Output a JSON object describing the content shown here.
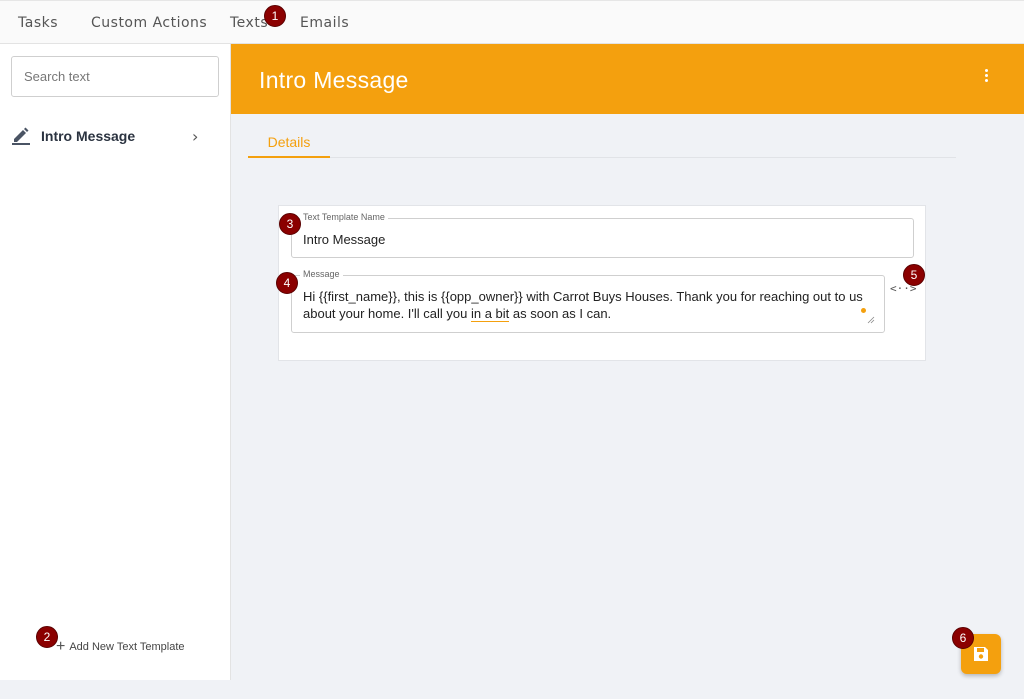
{
  "topnav": {
    "tabs": [
      {
        "label": "Tasks"
      },
      {
        "label": "Custom Actions"
      },
      {
        "label": "Texts"
      },
      {
        "label": "Emails"
      }
    ]
  },
  "markers": [
    "1",
    "2",
    "3",
    "4",
    "5",
    "6"
  ],
  "sidebar": {
    "search_placeholder": "Search text",
    "items": [
      {
        "label": "Intro Message",
        "icon": "pencil-icon"
      }
    ],
    "add_label": "Add New Text Template"
  },
  "main": {
    "header_title": "Intro Message",
    "tabs": [
      {
        "label": "Details"
      }
    ],
    "form": {
      "name_legend": "Text Template Name",
      "name_value": "Intro Message",
      "message_legend": "Message",
      "message_before": "Hi {{first_name}}, this is {{opp_owner}} with Carrot Buys Houses. Thank you for reaching out to us about your home. I'll call you ",
      "message_flag": "in a bit",
      "message_after": " as soon as I can."
    },
    "variable_icon": "<··>"
  },
  "colors": {
    "accent": "#f4a00e",
    "marker": "#8b0000",
    "background": "#f0f2f6"
  }
}
